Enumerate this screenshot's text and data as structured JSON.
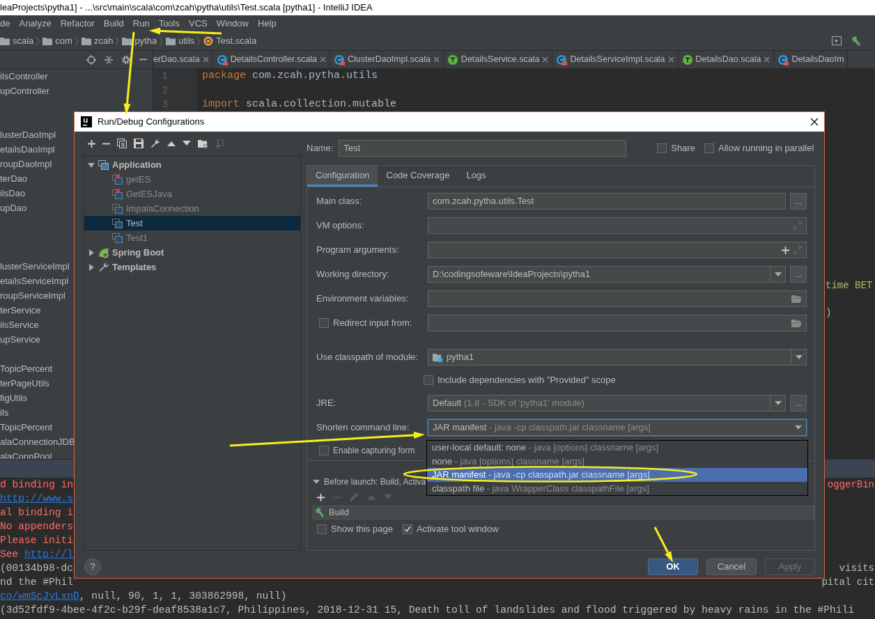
{
  "window": {
    "title": "leaProjects\\pytha1] - ...\\src\\main\\scala\\com\\zcah\\pytha\\utils\\Test.scala [pytha1] - IntelliJ IDEA"
  },
  "menu": [
    "de",
    "Analyze",
    "Refactor",
    "Build",
    "Run",
    "Tools",
    "VCS",
    "Window",
    "Help"
  ],
  "breadcrumbs": [
    {
      "label": "scala",
      "kind": "folder"
    },
    {
      "label": "com",
      "kind": "folder"
    },
    {
      "label": "zcah",
      "kind": "folder"
    },
    {
      "label": "pytha",
      "kind": "folder"
    },
    {
      "label": "utils",
      "kind": "folder"
    },
    {
      "label": "Test.scala",
      "kind": "object"
    }
  ],
  "project_panel": {
    "groups": [
      [
        "ilsController",
        "upController"
      ],
      [
        "lusterDaoImpl",
        "etailsDaoImpl",
        "roupDaoImpl",
        "terDao",
        "ilsDao",
        "upDao"
      ],
      [
        "lusterServiceImpl",
        "etailsServiceImpl",
        "roupServiceImpl",
        "terService",
        "ilsService",
        "upService"
      ],
      [
        "TopicPercent",
        "terPageUtils",
        "figUtils",
        "ils",
        "TopicPercent",
        "alaConnectionJDB",
        "alaConnPool"
      ]
    ]
  },
  "editor": {
    "tabs": [
      {
        "label": "erDao.scala",
        "closable": true
      },
      {
        "label": "DetailsController.scala",
        "kind": "class",
        "closable": true
      },
      {
        "label": "ClusterDaoImpl.scala",
        "kind": "class",
        "closable": true
      },
      {
        "label": "DetailsService.scala",
        "kind": "trait",
        "closable": true
      },
      {
        "label": "DetailsServiceImpl.scala",
        "kind": "class",
        "closable": true
      },
      {
        "label": "DetailsDao.scala",
        "kind": "trait",
        "closable": true
      },
      {
        "label": "DetailsDaoIm",
        "kind": "class",
        "closable": false
      }
    ],
    "lines": [
      {
        "number": "1",
        "keyword": "package",
        "code": "com.zcah.pytha.utils"
      },
      {
        "number": "2"
      },
      {
        "number": "3",
        "keyword": "import",
        "code": "scala.collection.mutable"
      }
    ],
    "fragments": [
      "time BET",
      ")"
    ]
  },
  "console": {
    "lines": [
      {
        "kind": "error",
        "left": [
          {
            "text": "d binding in"
          }
        ],
        "right": [
          {
            "text": "oggerBin"
          }
        ]
      },
      {
        "kind": "error",
        "left": [
          {
            "text": "http://www.s",
            "link": true
          }
        ]
      },
      {
        "kind": "error",
        "left": [
          {
            "text": "al binding i"
          }
        ]
      },
      {
        "kind": "error",
        "left": [
          {
            "text": "No appenders"
          }
        ]
      },
      {
        "kind": "error",
        "left": [
          {
            "text": "Please initi"
          }
        ]
      },
      {
        "kind": "error",
        "left": [
          {
            "text": "See "
          },
          {
            "text": "http://l",
            "link": true
          }
        ]
      },
      {
        "kind": "output",
        "left": [
          {
            "text": "(00134b98-dc"
          }
        ],
        "right": [
          {
            "text": "visits"
          }
        ]
      },
      {
        "kind": "output",
        "left": [
          {
            "text": "nd the #Phil"
          }
        ],
        "right": [
          {
            "text": "pital cit"
          }
        ]
      },
      {
        "kind": "output",
        "left": [
          {
            "text": "co/wmScJyLxnD",
            "link": true
          },
          {
            "text": ", null, 90, 1, 1, 303862998, null)"
          }
        ]
      },
      {
        "kind": "output",
        "left": [
          {
            "text": "(3d52fdf9-4bee-4f2c-b29f-deaf8538a1c7, Philippines, 2018-12-31 15, Death toll of landslides and flood triggered by heavy rains in the #Phili"
          }
        ]
      }
    ]
  },
  "dialog": {
    "title": "Run/Debug Configurations",
    "tree": [
      {
        "label": "Application",
        "kind": "application",
        "expanded": true,
        "selected": false,
        "children": [
          {
            "label": "getES",
            "error": true,
            "selected": false
          },
          {
            "label": "GetESJava",
            "error": true,
            "selected": false
          },
          {
            "label": "ImpalaConnection",
            "error": false,
            "selected": false
          },
          {
            "label": "Test",
            "error": false,
            "selected": true
          },
          {
            "label": "Test1",
            "error": false,
            "selected": false
          }
        ]
      },
      {
        "label": "Spring Boot",
        "kind": "spring",
        "expanded": false,
        "selected": false
      },
      {
        "label": "Templates",
        "kind": "templates",
        "expanded": false,
        "selected": false
      }
    ],
    "name": {
      "label": "Name:",
      "value": "Test"
    },
    "options": [
      {
        "label": "Share",
        "checked": false
      },
      {
        "label": "Allow running in parallel",
        "checked": false
      }
    ],
    "tabs": [
      {
        "label": "Configuration",
        "selected": true
      },
      {
        "label": "Code Coverage",
        "selected": false
      },
      {
        "label": "Logs",
        "selected": false
      }
    ],
    "fields": [
      {
        "kind": "browse",
        "label": "Main class:",
        "value": "com.zcah.pytha.utils.Test",
        "button": "..."
      },
      {
        "kind": "expand",
        "label": "VM options:"
      },
      {
        "kind": "args",
        "label": "Program arguments:"
      },
      {
        "kind": "path",
        "label": "Working directory:",
        "value": "D:\\codingsofeware\\IdeaProjects\\pytha1",
        "button": "..."
      },
      {
        "kind": "folder",
        "label": "Environment variables:"
      },
      {
        "kind": "redirect",
        "label": "Redirect input from:",
        "checked": false
      },
      {
        "kind": "module",
        "label": "Use classpath of module:",
        "value": "pytha1"
      },
      {
        "kind": "checkbox",
        "label": "Include dependencies with \"Provided\" scope",
        "checked": false
      },
      {
        "kind": "jre",
        "label": "JRE:",
        "value": "Default",
        "hint": "(1.8 - SDK of 'pytha1' module)",
        "button": "..."
      },
      {
        "kind": "shorten",
        "label": "Shorten command line:",
        "value": "JAR manifest",
        "hint": "- java -cp classpath.jar classname [args]",
        "focused": true
      },
      {
        "kind": "capture",
        "label": "Enable capturing form",
        "checked": false
      }
    ],
    "popup": [
      {
        "name": "user-local default: none",
        "description": "- java [options] classname [args]",
        "selected": false
      },
      {
        "name": "none",
        "description": "- java [options] classname [args]",
        "selected": false
      },
      {
        "name": "JAR manifest",
        "description": "- java -cp classpath.jar classname [args]",
        "selected": true
      },
      {
        "name": "classpath file",
        "description": "- java WrapperClass classpathFile [args]",
        "selected": false
      }
    ],
    "before_launch": {
      "label": "Before launch: Build, Activa",
      "expanded": true,
      "tasks": [
        "Build"
      ]
    },
    "launch_options": [
      {
        "label": "Show this page",
        "checked": false
      },
      {
        "label": "Activate tool window",
        "checked": true
      }
    ],
    "help": "?",
    "buttons": [
      {
        "label": "OK",
        "kind": "primary"
      },
      {
        "label": "Cancel",
        "kind": "default"
      },
      {
        "label": "Apply",
        "kind": "disabled"
      }
    ]
  }
}
